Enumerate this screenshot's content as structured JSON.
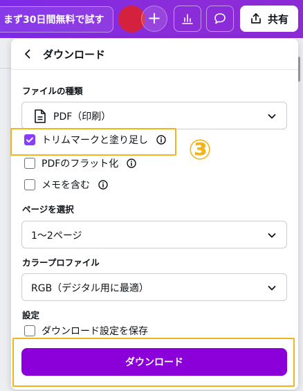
{
  "topbar": {
    "trial_button": "まず30日間無料で試す",
    "share_label": "共有"
  },
  "panel": {
    "title": "ダウンロード",
    "file_type": {
      "label": "ファイルの種類",
      "value": "PDF（印刷）"
    },
    "options": [
      {
        "label": "トリムマークと塗り足し",
        "checked": true,
        "info": true
      },
      {
        "label": "PDFのフラット化",
        "checked": false,
        "info": true
      },
      {
        "label": "メモを含む",
        "checked": false,
        "info": true
      }
    ],
    "page_select": {
      "label": "ページを選択",
      "value": "1〜2ページ"
    },
    "color_profile": {
      "label": "カラープロファイル",
      "value": "RGB（デジタル用に最適）"
    },
    "settings": {
      "label": "設定",
      "save_label": "ダウンロード設定を保存"
    },
    "download_button": "ダウンロード"
  },
  "annotation": {
    "step_number": "③",
    "highlight_color": "#f3b31c"
  },
  "colors": {
    "brand_purple": "#7d2ae8",
    "button_purple": "#8b00d8",
    "checkbox_purple": "#8b3dff",
    "avatar_red": "#d4213d"
  }
}
